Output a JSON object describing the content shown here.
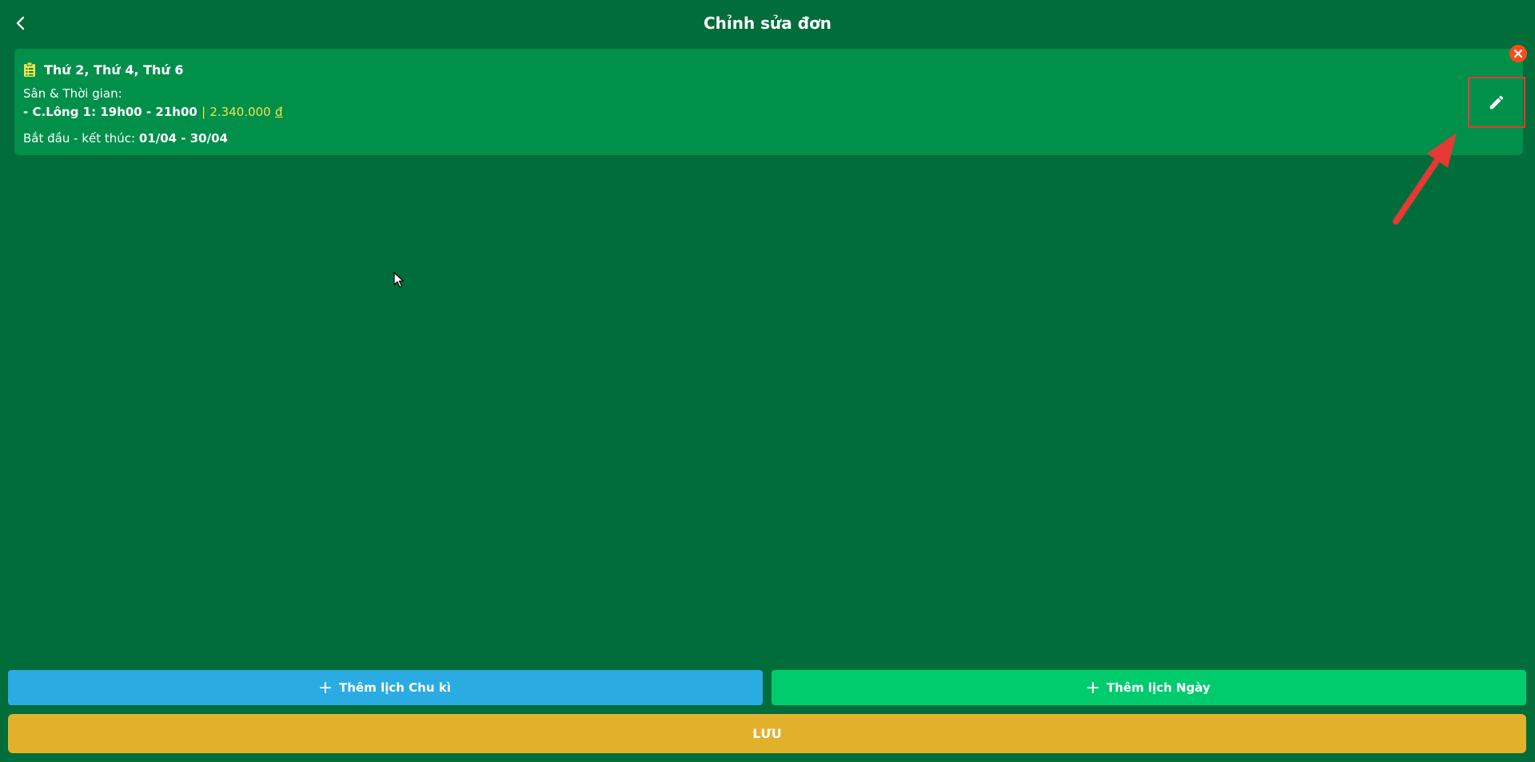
{
  "header": {
    "title": "Chỉnh sửa đơn",
    "back_icon": "chevron-left-icon"
  },
  "schedule_card": {
    "days": "Thứ 2, Thứ 4, Thứ 6",
    "days_icon": "calendar-icon",
    "court_time_label": "Sân & Thời gian:",
    "slot": "- C.Lông 1: 19h00 - 21h00",
    "price_separator": "|",
    "price": "2.340.000",
    "currency": "đ",
    "range_label": "Bắt đầu - kết thúc:",
    "range_value": "01/04 - 30/04",
    "edit_icon": "pencil-icon",
    "remove_icon": "close-icon"
  },
  "actions": {
    "add_cycle_label": "Thêm lịch Chu kì",
    "add_day_label": "Thêm lịch Ngày",
    "save_label": "LƯU",
    "plus_icon": "plus-icon"
  },
  "colors": {
    "background": "#006d3a",
    "card": "#00904a",
    "price": "#f5e24a",
    "cycle_button": "#2aace2",
    "day_button": "#00cc6e",
    "save_button": "#e2b12c",
    "remove_badge": "#ff4a1c",
    "annotation": "#e53935"
  }
}
